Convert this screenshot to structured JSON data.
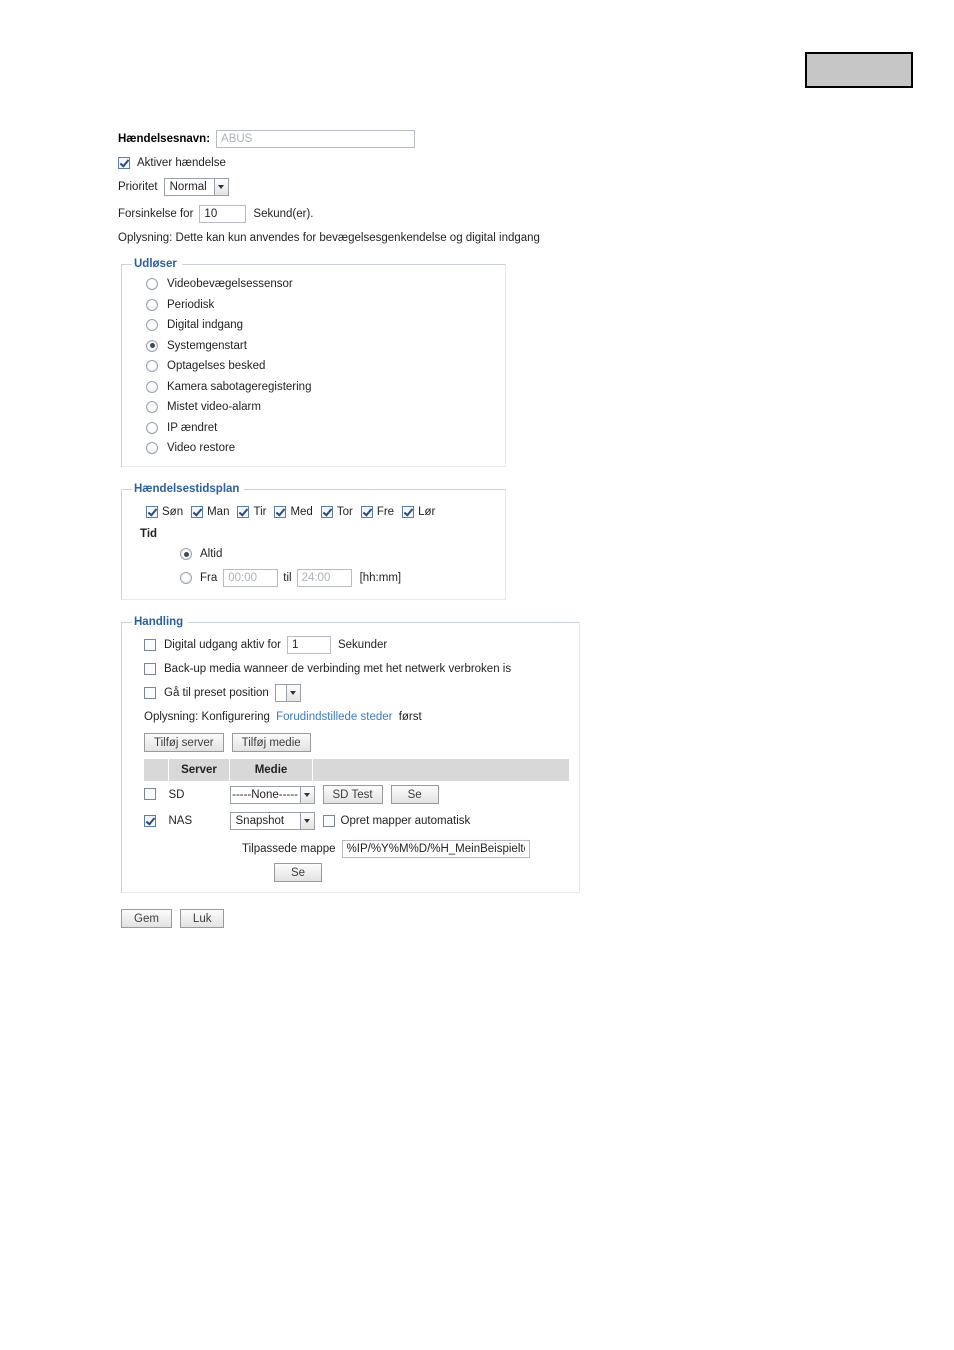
{
  "header": {
    "redacted_block": ""
  },
  "general": {
    "event_name_label": "Hændelsesnavn:",
    "event_name_value": "ABUS",
    "enable_event_label": "Aktiver hændelse",
    "enable_event_checked": true,
    "priority_label": "Prioritet",
    "priority_value": "Normal",
    "delay_label": "Forsinkelse for",
    "delay_value": "10",
    "delay_unit": "Sekund(er).",
    "info_note": "Oplysning: Dette kan kun anvendes for bevægelsesgenkendelse og digital indgang"
  },
  "trigger": {
    "legend": "Udløser",
    "selected": "Systemgenstart",
    "options": [
      {
        "label": "Videobevægelsessensor",
        "selected": false
      },
      {
        "label": "Periodisk",
        "selected": false
      },
      {
        "label": "Digital indgang",
        "selected": false
      },
      {
        "label": "Systemgenstart",
        "selected": true
      },
      {
        "label": "Optagelses besked",
        "selected": false
      },
      {
        "label": "Kamera sabotageregistering",
        "selected": false
      },
      {
        "label": "Mistet video-alarm",
        "selected": false
      },
      {
        "label": "IP ændret",
        "selected": false
      },
      {
        "label": "Video restore",
        "selected": false
      }
    ]
  },
  "schedule": {
    "legend": "Hændelsestidsplan",
    "days": [
      {
        "label": "Søn",
        "checked": true
      },
      {
        "label": "Man",
        "checked": true
      },
      {
        "label": "Tir",
        "checked": true
      },
      {
        "label": "Med",
        "checked": true
      },
      {
        "label": "Tor",
        "checked": true
      },
      {
        "label": "Fre",
        "checked": true
      },
      {
        "label": "Lør",
        "checked": true
      }
    ],
    "time_title": "Tid",
    "always_label": "Altid",
    "always_selected": true,
    "from_label": "Fra",
    "from_value": "00:00",
    "to_label": "til",
    "to_value": "24:00",
    "format_hint": "[hh:mm]",
    "range_selected": false
  },
  "action": {
    "legend": "Handling",
    "digital_output_label": "Digital udgang aktiv for",
    "digital_output_checked": false,
    "digital_output_seconds": "1",
    "digital_output_unit": "Sekunder",
    "backup_media_label": "Back-up media wanneer de verbinding met het netwerk verbroken is",
    "backup_media_checked": false,
    "preset_label": "Gå til preset position",
    "preset_checked": false,
    "preset_value": "",
    "info_prefix": "Oplysning: Konfigurering",
    "info_link": "Forudindstillede steder",
    "info_suffix": "først",
    "add_server_button": "Tilføj server",
    "add_media_button": "Tilføj medie",
    "table": {
      "headers": [
        "",
        "Server",
        "Medie",
        ""
      ],
      "rows": [
        {
          "checked": false,
          "server": "SD",
          "media": "-----None-----",
          "buttons": [
            "SD Test",
            "Se"
          ]
        },
        {
          "checked": true,
          "server": "NAS",
          "media": "Snapshot",
          "auto_folder_label": "Opret mapper automatisk",
          "auto_folder_checked": false
        }
      ]
    },
    "custom_folder_label": "Tilpassede mappe",
    "custom_folder_value": "%IP/%Y%M%D/%H_MeinBeispieltext",
    "browse_button": "Se"
  },
  "footer": {
    "save_button": "Gem",
    "close_button": "Luk"
  }
}
